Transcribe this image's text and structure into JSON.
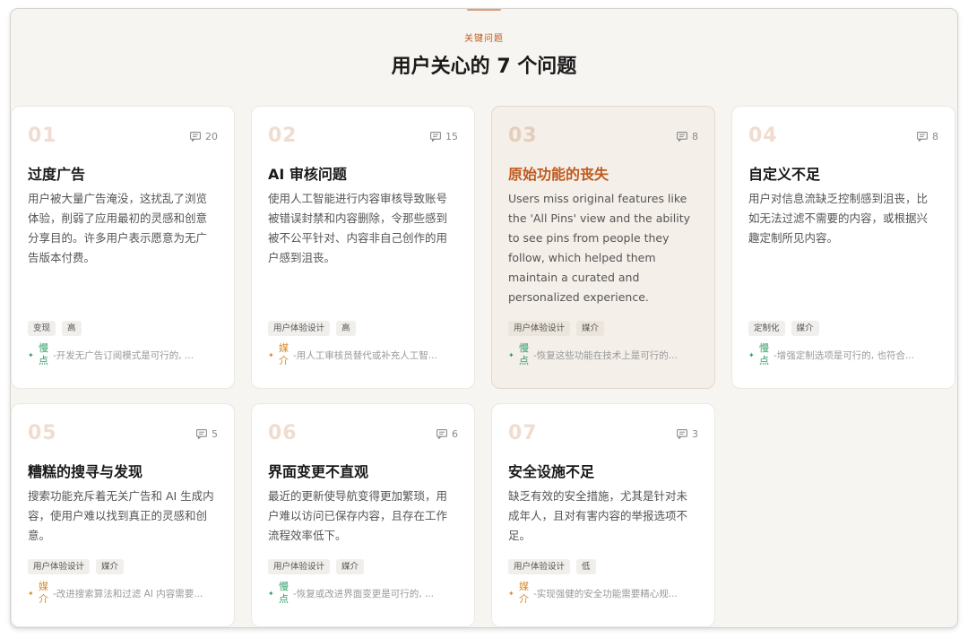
{
  "header": {
    "eyebrow": "关键问题",
    "title": "用户关心的 7 个问题"
  },
  "colors": {
    "accent": "#c05a1f",
    "slow_sentiment": "#2e9e6a",
    "media_sentiment": "#d98a2a"
  },
  "cards": [
    {
      "num": "01",
      "count": "20",
      "title": "过度广告",
      "desc": "用户被大量广告淹没，这扰乱了浏览体验，削弱了应用最初的灵感和创意分享目的。许多用户表示愿意为无广告版本付费。",
      "tags": [
        "变现",
        "高"
      ],
      "sentiment_label": "慢点",
      "sentiment_type": "slow",
      "sentiment_text": "-开发无广告订阅模式是可行的, ..."
    },
    {
      "num": "02",
      "count": "15",
      "title": "AI 审核问题",
      "desc": "使用人工智能进行内容审核导致账号被错误封禁和内容删除，令那些感到被不公平针对、内容非自己创作的用户感到沮丧。",
      "tags": [
        "用户体验设计",
        "高"
      ],
      "sentiment_label": "媒介",
      "sentiment_type": "media",
      "sentiment_text": "-用人工审核员替代或补充人工智..."
    },
    {
      "num": "03",
      "count": "8",
      "title": "原始功能的丧失",
      "desc": "Users miss original features like the 'All Pins' view and the ability to see pins from people they follow, which helped them maintain a curated and personalized experience.",
      "tags": [
        "用户体验设计",
        "媒介"
      ],
      "sentiment_label": "慢点",
      "sentiment_type": "slow",
      "sentiment_text": "-恢复这些功能在技术上是可行的..."
    },
    {
      "num": "04",
      "count": "8",
      "title": "自定义不足",
      "desc": "用户对信息流缺乏控制感到沮丧，比如无法过滤不需要的内容，或根据兴趣定制所见内容。",
      "tags": [
        "定制化",
        "媒介"
      ],
      "sentiment_label": "慢点",
      "sentiment_type": "slow",
      "sentiment_text": "-增强定制选项是可行的, 也符合..."
    },
    {
      "num": "05",
      "count": "5",
      "title": "糟糕的搜寻与发现",
      "desc": "搜索功能充斥着无关广告和 AI 生成内容，使用户难以找到真正的灵感和创意。",
      "tags": [
        "用户体验设计",
        "媒介"
      ],
      "sentiment_label": "媒介",
      "sentiment_type": "media",
      "sentiment_text": "-改进搜索算法和过滤 AI 内容需要..."
    },
    {
      "num": "06",
      "count": "6",
      "title": "界面变更不直观",
      "desc": "最近的更新使导航变得更加繁琐，用户难以访问已保存内容，且存在工作流程效率低下。",
      "tags": [
        "用户体验设计",
        "媒介"
      ],
      "sentiment_label": "慢点",
      "sentiment_type": "slow",
      "sentiment_text": "-恢复或改进界面变更是可行的, ..."
    },
    {
      "num": "07",
      "count": "3",
      "title": "安全设施不足",
      "desc": "缺乏有效的安全措施，尤其是针对未成年人，且对有害内容的举报选项不足。",
      "tags": [
        "用户体验设计",
        "低"
      ],
      "sentiment_label": "媒介",
      "sentiment_type": "media",
      "sentiment_text": "-实现强健的安全功能需要精心规..."
    }
  ]
}
